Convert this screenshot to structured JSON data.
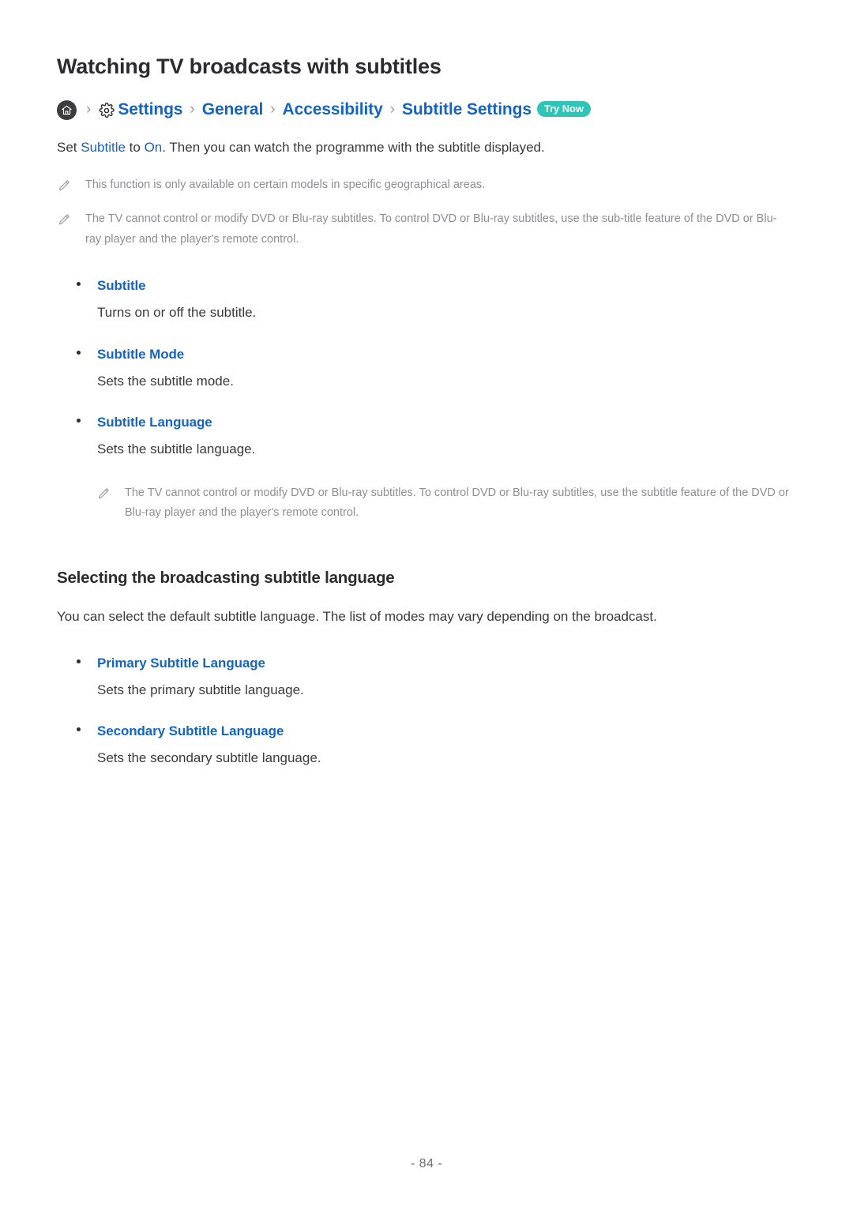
{
  "page": {
    "title": "Watching TV broadcasts with subtitles",
    "page_number": "- 84 -",
    "accent_blue": "#1565c0",
    "badge_teal": "#2ec4b6",
    "note_grey": "#8e8e93"
  },
  "breadcrumb": {
    "home_icon": "home-icon",
    "gear_icon": "gear-icon",
    "separator": "›",
    "items": [
      {
        "label": "Settings"
      },
      {
        "label": "General"
      },
      {
        "label": "Accessibility"
      },
      {
        "label": "Subtitle Settings"
      }
    ],
    "badge": "Try Now"
  },
  "intro": {
    "prefix": "Set ",
    "keyword1": "Subtitle",
    "middle": " to ",
    "keyword2": "On",
    "suffix": ". Then you can watch the programme with the subtitle displayed."
  },
  "notes": [
    {
      "icon": "pencil-icon",
      "text": "This function is only available on certain models in specific geographical areas."
    },
    {
      "icon": "pencil-icon",
      "text": "The TV cannot control or modify DVD or Blu-ray subtitles. To control DVD or Blu-ray subtitles, use the sub-title feature of the DVD or Blu-ray player and the player's remote control."
    }
  ],
  "settings_list": [
    {
      "label": "Subtitle",
      "description": "Turns on or off the subtitle."
    },
    {
      "label": "Subtitle Mode",
      "description": "Sets the subtitle mode."
    },
    {
      "label": "Subtitle Language",
      "description": "Sets the subtitle language."
    }
  ],
  "nested_note": {
    "icon": "pencil-icon",
    "text": "The TV cannot control or modify DVD or Blu-ray subtitles. To control DVD or Blu-ray subtitles, use the subtitle feature of the DVD or Blu-ray player and the player's remote control."
  },
  "section": {
    "heading": "Selecting the broadcasting subtitle language",
    "intro": "You can select the default subtitle language. The list of modes may vary depending on the broadcast."
  },
  "language_list": [
    {
      "label": "Primary Subtitle Language",
      "description": "Sets the primary subtitle language."
    },
    {
      "label": "Secondary Subtitle Language",
      "description": "Sets the secondary subtitle language."
    }
  ]
}
